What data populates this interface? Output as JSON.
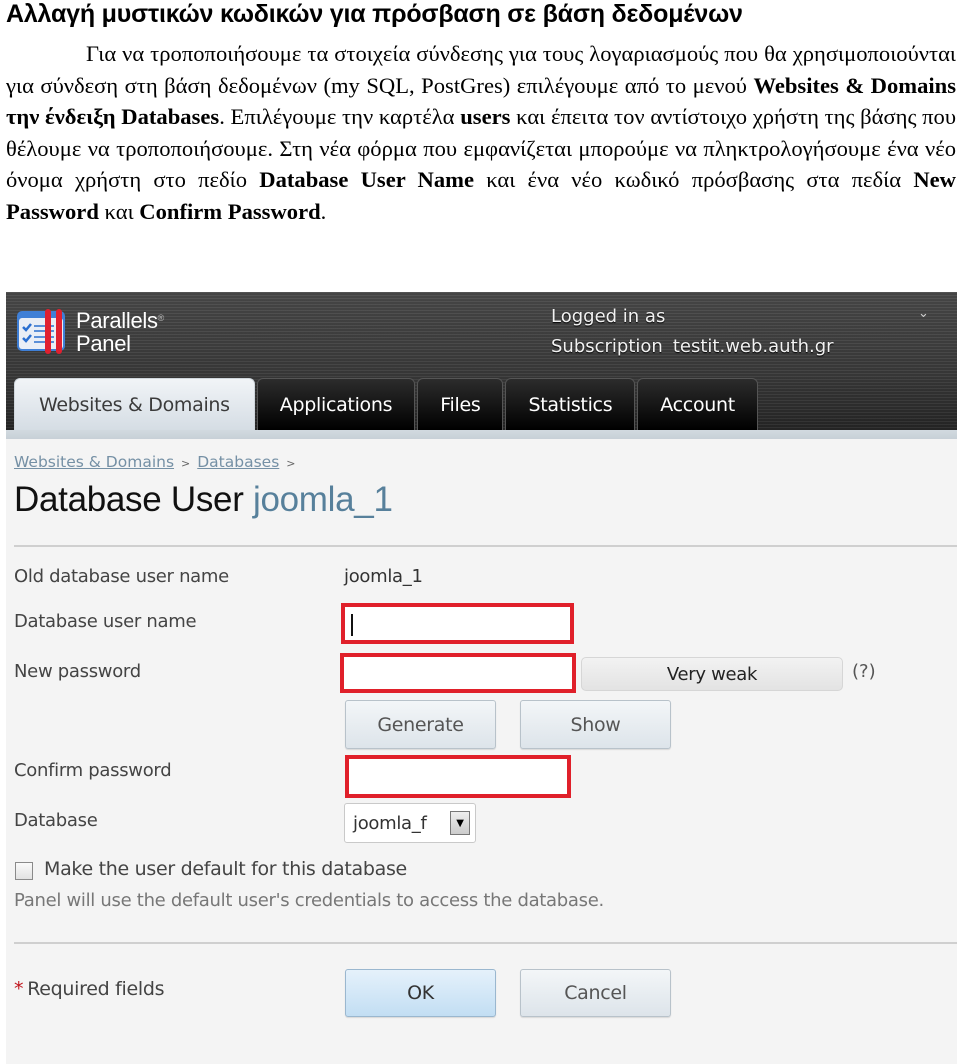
{
  "document": {
    "title": "Αλλαγή μυστικών κωδικών για πρόσβαση σε βάση δεδομένων",
    "paragraph": [
      {
        "text": "Για να τροποποιήσουμε τα στοιχεία σύνδεσης για τους λογαριασμούς που θα χρησιμοποιούνται  για σύνδεση στη βάση δεδομένων (my SQL, PostGres) επιλέγουμε από το μενού ",
        "bold": false
      },
      {
        "text": "Websites & Domains την ένδειξη  Databases",
        "bold": true
      },
      {
        "text": ". Επιλέγουμε την καρτέλα ",
        "bold": false
      },
      {
        "text": "users",
        "bold": true
      },
      {
        "text": " και έπειτα τον αντίστοιχο χρήστη της βάσης που θέλουμε να τροποποιήσουμε. Στη νέα φόρμα που εμφανίζεται μπορούμε να πληκτρολογήσουμε ένα νέο όνομα χρήστη στο πεδίο ",
        "bold": false
      },
      {
        "text": "Database User Name",
        "bold": true
      },
      {
        "text": " και ένα νέο κωδικό πρόσβασης στα πεδία ",
        "bold": false
      },
      {
        "text": "New Password",
        "bold": true
      },
      {
        "text": " και ",
        "bold": false
      },
      {
        "text": "Confirm Password",
        "bold": true
      },
      {
        "text": ".",
        "bold": false
      }
    ]
  },
  "panel": {
    "logo": {
      "line1": "Parallels",
      "registered": "®",
      "line2": "Panel",
      "icon": "checklist-icon"
    },
    "login": {
      "logged_in_label": "Logged in as",
      "subscription_label": "Subscription",
      "subscription_value": "testit.web.auth.gr",
      "menu_icon": "chevron-down-icon"
    },
    "tabs": [
      {
        "label": "Websites & Domains",
        "active": true
      },
      {
        "label": "Applications",
        "active": false
      },
      {
        "label": "Files",
        "active": false
      },
      {
        "label": "Statistics",
        "active": false
      },
      {
        "label": "Account",
        "active": false
      }
    ],
    "breadcrumb": [
      {
        "label": "Websites & Domains"
      },
      {
        "label": "Databases"
      }
    ],
    "breadcrumb_separator": ">",
    "page_title": {
      "prefix": "Database User",
      "subject": "joomla_1"
    },
    "form": {
      "old_user_label": "Old database user name",
      "old_user_value": "joomla_1",
      "user_name_label": "Database user name",
      "user_name_value": "",
      "new_password_label": "New password",
      "new_password_value": "",
      "strength": "Very weak",
      "help": "(?)",
      "generate_label": "Generate",
      "show_label": "Show",
      "confirm_password_label": "Confirm password",
      "confirm_password_value": "",
      "database_label": "Database",
      "database_selected": "joomla_f",
      "default_checkbox_label": "Make the user default for this database",
      "default_checkbox_checked": false,
      "default_hint": "Panel will use the default user's credentials to access the database.",
      "required_star": "*",
      "required_label": "Required fields",
      "ok_label": "OK",
      "cancel_label": "Cancel"
    },
    "highlight_color": "#e0202a",
    "link_color": "#7590a5"
  }
}
